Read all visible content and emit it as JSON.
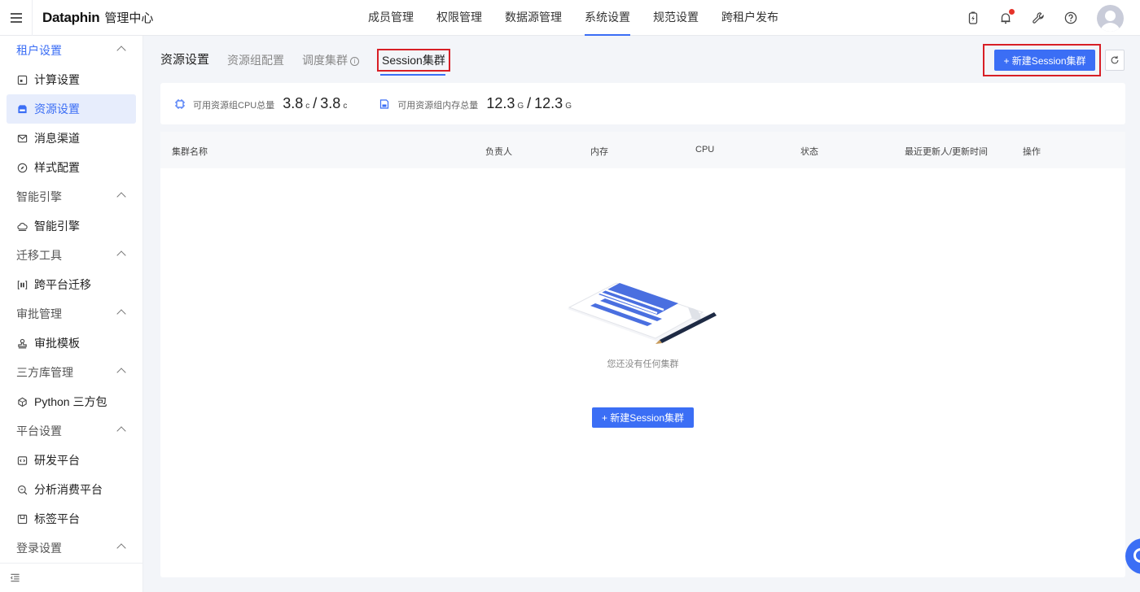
{
  "header": {
    "logo": "Dataphin",
    "subtitle": "管理中心",
    "nav": [
      "成员管理",
      "权限管理",
      "数据源管理",
      "系统设置",
      "规范设置",
      "跨租户发布"
    ],
    "active_nav": "系统设置"
  },
  "sidebar": {
    "groups": [
      {
        "label": "租户设置",
        "items": [
          {
            "label": "计算设置",
            "icon": "calc-icon"
          },
          {
            "label": "资源设置",
            "icon": "resource-icon",
            "active": true
          },
          {
            "label": "消息渠道",
            "icon": "mail-icon"
          },
          {
            "label": "样式配置",
            "icon": "compass-icon"
          }
        ]
      },
      {
        "label": "智能引擎",
        "items": [
          {
            "label": "智能引擎",
            "icon": "cloud-icon"
          }
        ]
      },
      {
        "label": "迁移工具",
        "items": [
          {
            "label": "跨平台迁移",
            "icon": "migrate-icon"
          }
        ]
      },
      {
        "label": "审批管理",
        "items": [
          {
            "label": "审批模板",
            "icon": "stamp-icon"
          }
        ]
      },
      {
        "label": "三方库管理",
        "items": [
          {
            "label": "Python 三方包",
            "icon": "python-icon"
          }
        ]
      },
      {
        "label": "平台设置",
        "items": [
          {
            "label": "研发平台",
            "icon": "code-icon"
          },
          {
            "label": "分析消费平台",
            "icon": "analysis-icon"
          },
          {
            "label": "标签平台",
            "icon": "tag-icon"
          }
        ]
      },
      {
        "label": "登录设置",
        "items": []
      }
    ]
  },
  "tabs": {
    "resource": "资源设置",
    "group_config": "资源组配置",
    "schedule_cluster": "调度集群",
    "session_cluster": "Session集群"
  },
  "actions": {
    "new_session": "+ 新建Session集群"
  },
  "stats": {
    "cpu_label": "可用资源组CPU总量",
    "cpu_available": "3.8",
    "cpu_total": "3.8",
    "cpu_unit": "c",
    "mem_label": "可用资源组内存总量",
    "mem_available": "12.3",
    "mem_total": "12.3",
    "mem_unit": "G"
  },
  "table": {
    "columns": [
      "集群名称",
      "负责人",
      "内存",
      "CPU",
      "状态",
      "最近更新人/更新时间",
      "操作"
    ],
    "empty_text": "您还没有任何集群",
    "empty_button": "+ 新建Session集群"
  },
  "colors": {
    "accent": "#3b6ef5",
    "highlight_border": "#d81f26"
  }
}
